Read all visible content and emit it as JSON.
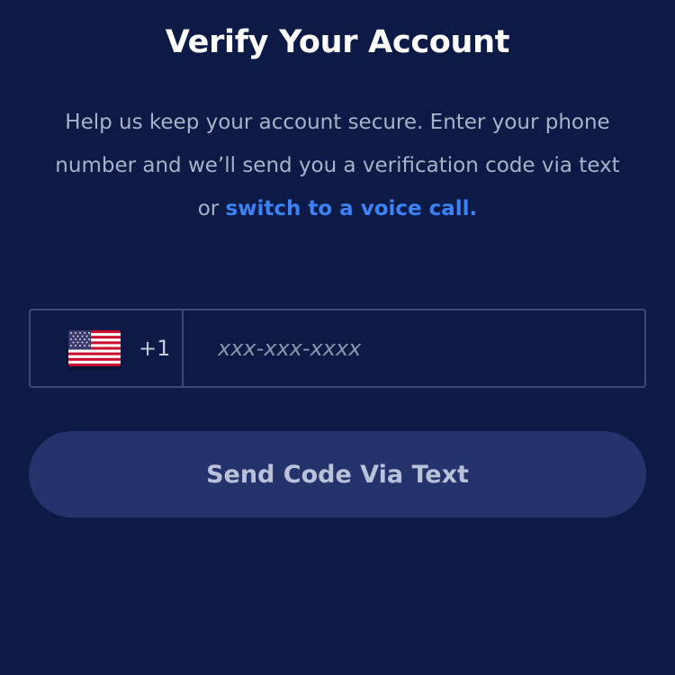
{
  "header": {
    "title": "Verify Your Account"
  },
  "description": {
    "text": "Help us keep your account secure. Enter your phone number and we’ll send you a verification code via text or ",
    "link_label": "switch to a voice call."
  },
  "phone": {
    "country_flag_icon": "us-flag-icon",
    "dial_code": "+1",
    "placeholder": "xxx-xxx-xxxx",
    "value": ""
  },
  "actions": {
    "send_label": "Send Code Via Text"
  },
  "colors": {
    "background": "#0d1a45",
    "link": "#3b82f6",
    "button_bg": "#24336b",
    "border": "#3a4a78"
  }
}
